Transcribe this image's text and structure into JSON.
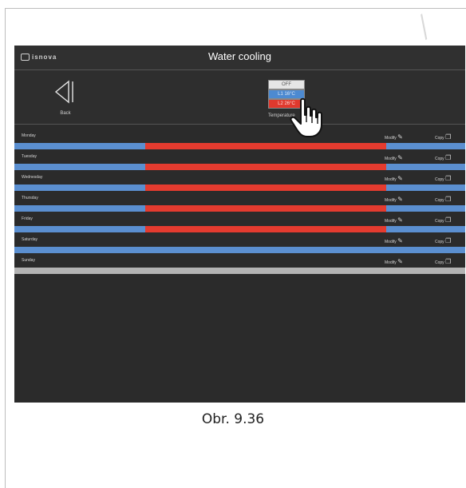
{
  "app": {
    "logo_text": "isnova",
    "title": "Water cooling"
  },
  "header": {
    "back_label": "Back",
    "mode_options": [
      "OFF",
      "L1 16°C",
      "L2 26°C"
    ],
    "mode_label": "Temperature"
  },
  "colors": {
    "l1": "#5b8fd0",
    "l2": "#e43b2f",
    "off": "#b3b3b3"
  },
  "schedule": {
    "modify_label": "Modify",
    "copy_label": "Copy",
    "days": [
      {
        "name": "Monday",
        "segments": [
          {
            "mode": "l1",
            "start": 0,
            "end": 0.29
          },
          {
            "mode": "l2",
            "start": 0.29,
            "end": 0.825
          },
          {
            "mode": "l1",
            "start": 0.825,
            "end": 1
          }
        ]
      },
      {
        "name": "Tuesday",
        "segments": [
          {
            "mode": "l1",
            "start": 0,
            "end": 0.29
          },
          {
            "mode": "l2",
            "start": 0.29,
            "end": 0.825
          },
          {
            "mode": "l1",
            "start": 0.825,
            "end": 1
          }
        ]
      },
      {
        "name": "Wednesday",
        "segments": [
          {
            "mode": "l1",
            "start": 0,
            "end": 0.29
          },
          {
            "mode": "l2",
            "start": 0.29,
            "end": 0.825
          },
          {
            "mode": "l1",
            "start": 0.825,
            "end": 1
          }
        ]
      },
      {
        "name": "Thursday",
        "segments": [
          {
            "mode": "l1",
            "start": 0,
            "end": 0.29
          },
          {
            "mode": "l2",
            "start": 0.29,
            "end": 0.825
          },
          {
            "mode": "l1",
            "start": 0.825,
            "end": 1
          }
        ]
      },
      {
        "name": "Friday",
        "segments": [
          {
            "mode": "l1",
            "start": 0,
            "end": 0.29
          },
          {
            "mode": "l2",
            "start": 0.29,
            "end": 0.825
          },
          {
            "mode": "l1",
            "start": 0.825,
            "end": 1
          }
        ]
      },
      {
        "name": "Saturday",
        "segments": [
          {
            "mode": "l1",
            "start": 0,
            "end": 1
          }
        ]
      },
      {
        "name": "Sunday",
        "segments": [
          {
            "mode": "off",
            "start": 0,
            "end": 1
          }
        ]
      }
    ]
  },
  "caption": "Obr. 9.36"
}
